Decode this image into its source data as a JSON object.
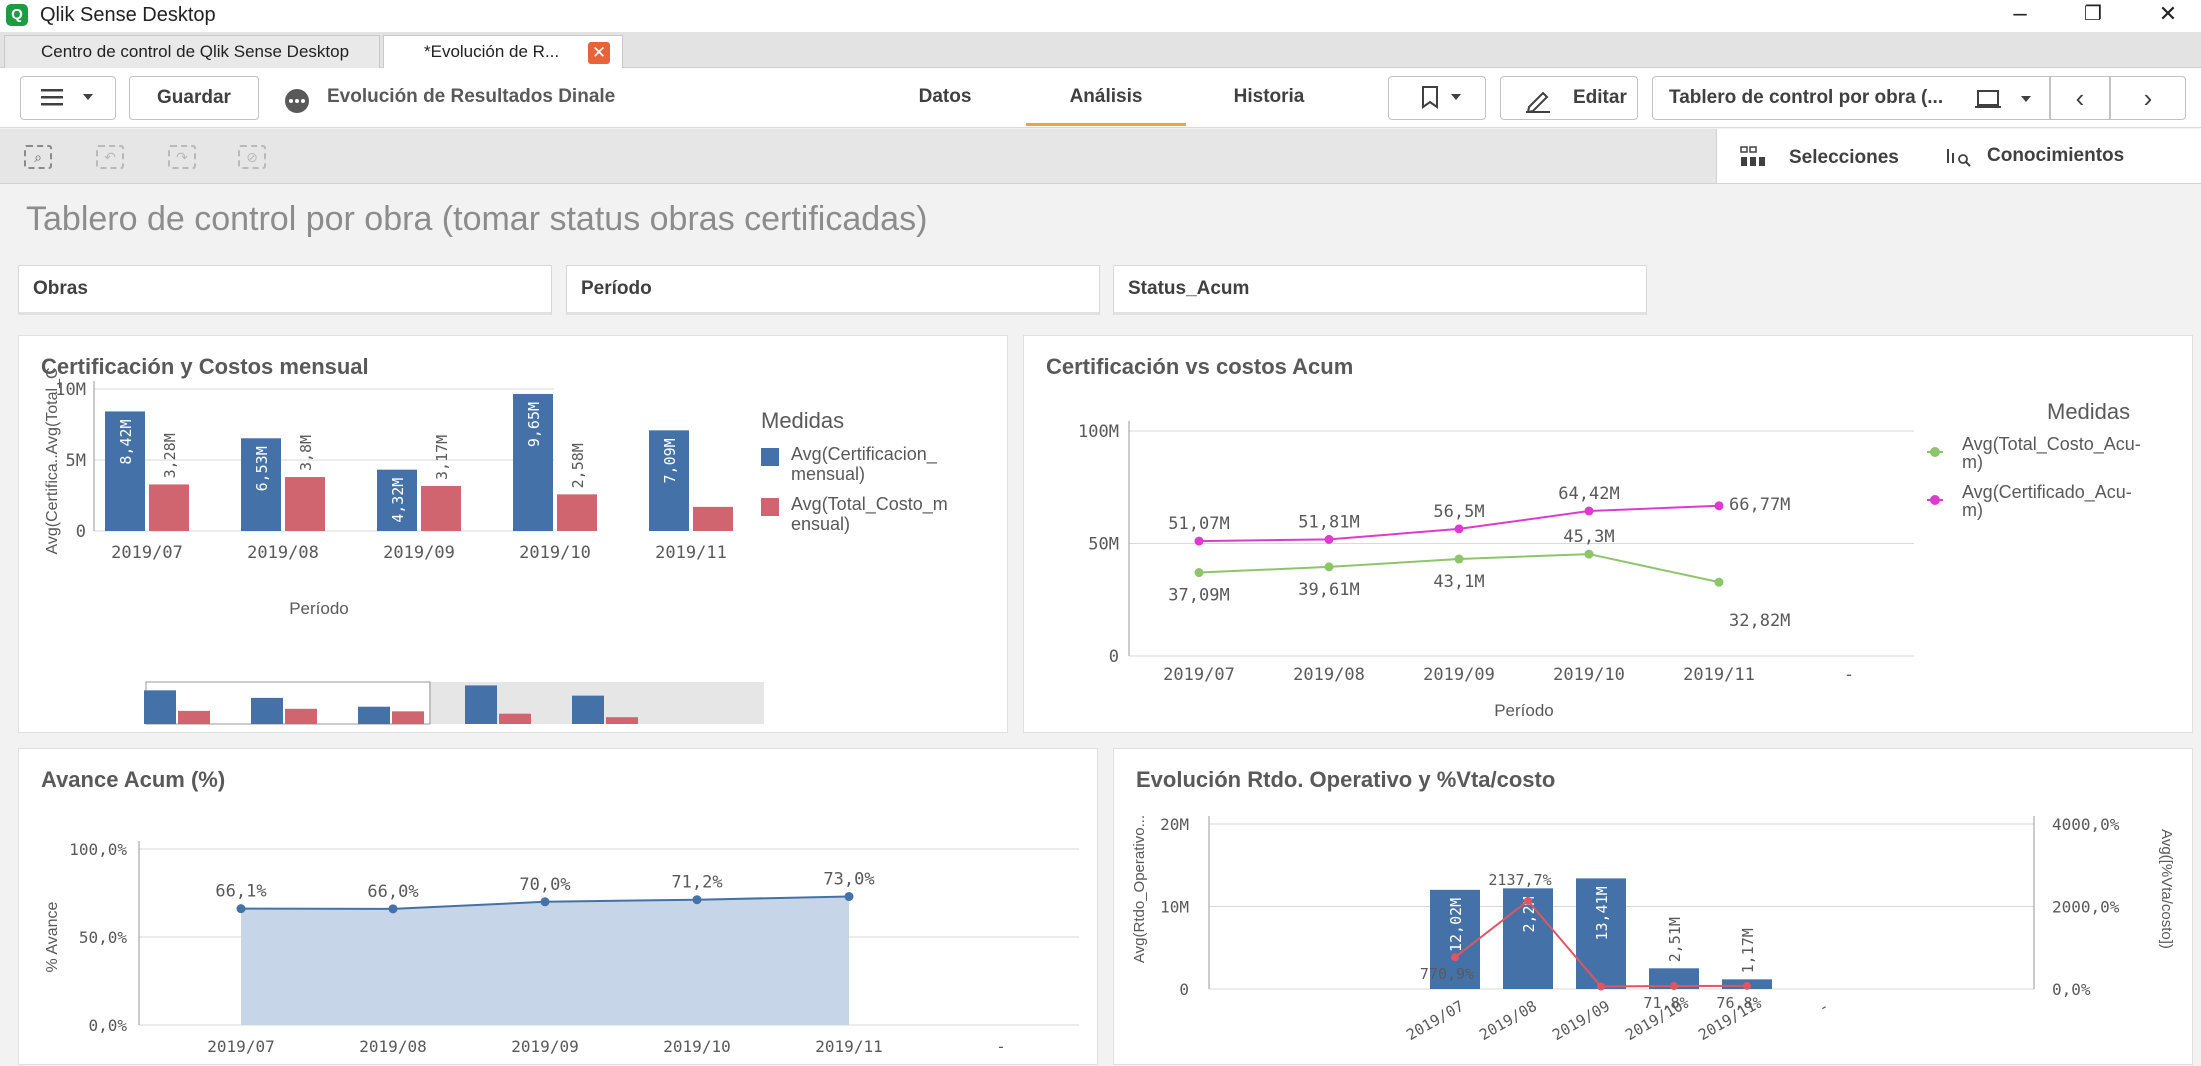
{
  "window": {
    "app_title": "Qlik Sense Desktop",
    "minimize": "–",
    "restore": "❐",
    "close": "✕"
  },
  "tabs": [
    {
      "label": "Centro de control de Qlik Sense Desktop"
    },
    {
      "label": "*Evolución de R...",
      "close": "✕"
    }
  ],
  "toolbar": {
    "save_label": "Guardar",
    "app_name": "Evolución de Resultados Dinale",
    "nav": [
      "Datos",
      "Análisis",
      "Historia"
    ],
    "edit_label": "Editar",
    "sheet_selector": "Tablero de control por obra (..."
  },
  "subtoolbar": {
    "selections_label": "Selecciones",
    "insights_label": "Conocimientos"
  },
  "sheet_title": "Tablero de control por obra (tomar status obras certificadas)",
  "filters": [
    "Obras",
    "Período",
    "Status_Acum"
  ],
  "colors": {
    "blue": "#4472a8",
    "red": "#d0646f",
    "green": "#8dc56b",
    "magenta": "#de3ad0",
    "accent": "#f0a141"
  },
  "chart_data": [
    {
      "type": "bar",
      "title": "Certificación y Costos mensual",
      "categories": [
        "2019/07",
        "2019/08",
        "2019/09",
        "2019/10",
        "2019/11"
      ],
      "xlabel": "Período",
      "ylabel": "Avg(Certifica..Avg(Total_C",
      "y_ticks": [
        "10M",
        "5M",
        "0"
      ],
      "ylim": [
        0,
        10
      ],
      "legend_title": "Medidas",
      "series": [
        {
          "name": "Avg(Certificacion_ mensual)",
          "values": [
            8.42,
            6.53,
            4.32,
            9.65,
            7.09
          ],
          "labels": [
            "8,42M",
            "6,53M",
            "4,32M",
            "9,65M",
            "7,09M"
          ]
        },
        {
          "name": "Avg(Total_Costo_m ensual)",
          "values": [
            3.28,
            3.8,
            3.17,
            2.58,
            1.7
          ],
          "labels": [
            "3,28M",
            "3,8M",
            "3,17M",
            "2,58M",
            ""
          ]
        }
      ]
    },
    {
      "type": "line",
      "title": "Certificación vs costos Acum",
      "categories": [
        "2019/07",
        "2019/08",
        "2019/09",
        "2019/10",
        "2019/11",
        "-"
      ],
      "xlabel": "Período",
      "y_ticks": [
        "100M",
        "50M",
        "0"
      ],
      "ylim": [
        0,
        100
      ],
      "legend_title": "Medidas",
      "series": [
        {
          "name": "Avg(Total_Costo_Acu- m)",
          "values": [
            37.09,
            39.61,
            43.1,
            45.3,
            32.82
          ],
          "labels": [
            "37,09M",
            "39,61M",
            "43,1M",
            "45,3M",
            "32,82M"
          ]
        },
        {
          "name": "Avg(Certificado_Acu- m)",
          "values": [
            51.07,
            51.81,
            56.5,
            64.42,
            66.77
          ],
          "labels": [
            "51,07M",
            "51,81M",
            "56,5M",
            "64,42M",
            "66,77M"
          ]
        }
      ]
    },
    {
      "type": "area",
      "title": "Avance Acum (%)",
      "categories": [
        "2019/07",
        "2019/08",
        "2019/09",
        "2019/10",
        "2019/11",
        "-"
      ],
      "ylabel": "% Avance",
      "y_ticks": [
        "100,0%",
        "50,0%",
        "0,0%"
      ],
      "ylim": [
        0,
        100
      ],
      "series": [
        {
          "name": "% Avance",
          "values": [
            66.1,
            66.0,
            70.0,
            71.2,
            73.0
          ],
          "labels": [
            "66,1%",
            "66,0%",
            "70,0%",
            "71,2%",
            "73,0%"
          ]
        }
      ]
    },
    {
      "type": "bar",
      "title": "Evolución Rtdo. Operativo y %Vta/costo",
      "categories": [
        "2019/07",
        "2019/08",
        "2019/09",
        "2019/10",
        "2019/11",
        "-"
      ],
      "ylabel": "Avg(Rtdo_Operativo...",
      "y2label": "Avg([%Vta/costo])",
      "y_ticks": [
        "20M",
        "10M",
        "0"
      ],
      "y2_ticks": [
        "4000,0%",
        "2000,0%",
        "0,0%"
      ],
      "ylim": [
        0,
        20
      ],
      "y2lim": [
        0,
        4000
      ],
      "series": [
        {
          "name": "Avg(Rtdo_Operativo)",
          "values": [
            12.02,
            12.2,
            13.41,
            2.51,
            1.17
          ],
          "labels": [
            "12,02M",
            "2,2M",
            "13,41M",
            "2,51M",
            "1,17M"
          ]
        },
        {
          "name": "Avg([%Vta/costo])",
          "values": [
            770.9,
            2137.7,
            60,
            71.8,
            76.8
          ],
          "labels": [
            "770,9%",
            "2137,7%",
            "",
            "71,8%",
            "76,8%"
          ]
        }
      ]
    }
  ]
}
